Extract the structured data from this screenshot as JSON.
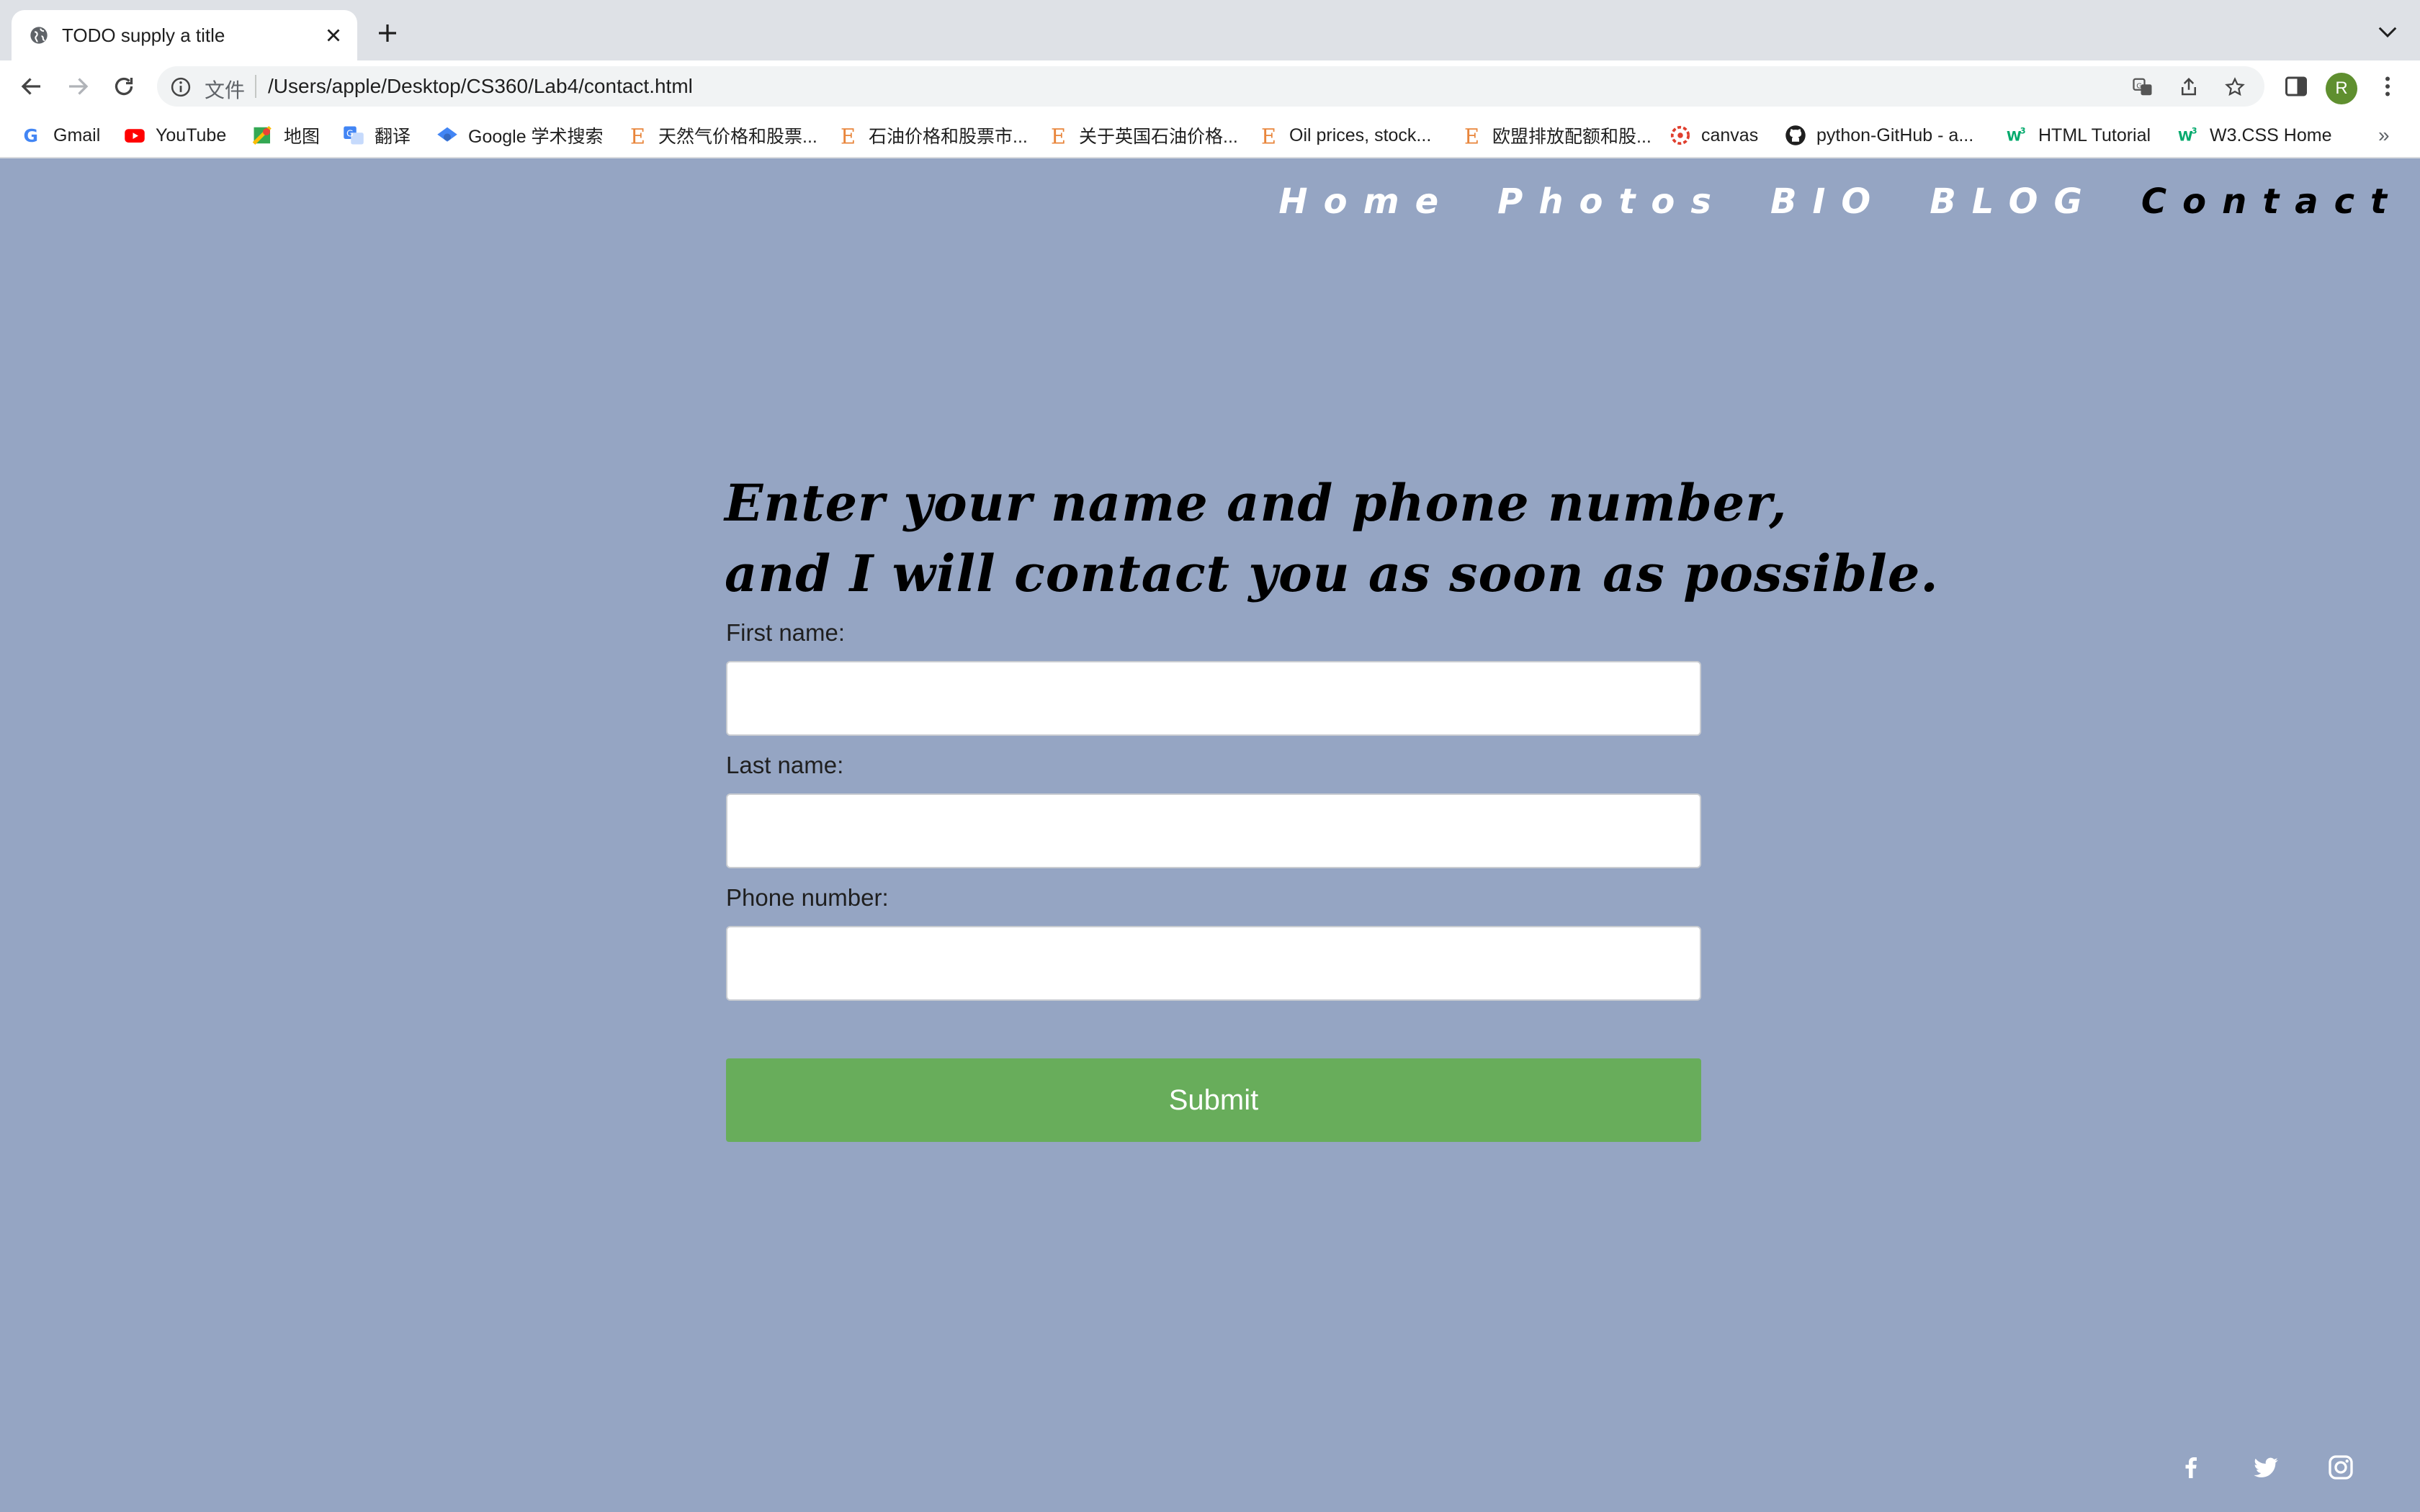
{
  "browser": {
    "tab_title": "TODO supply a title",
    "omnibox_scheme": "文件",
    "url": "/Users/apple/Desktop/CS360/Lab4/contact.html",
    "profile_initial": "R",
    "bookmarks": [
      {
        "label": "Gmail",
        "icon": "gmail-icon"
      },
      {
        "label": "YouTube",
        "icon": "youtube-icon"
      },
      {
        "label": "地图",
        "icon": "maps-icon"
      },
      {
        "label": "翻译",
        "icon": "translate-icon"
      },
      {
        "label": "Google 学术搜索",
        "icon": "scholar-icon"
      },
      {
        "label": "天然气价格和股票...",
        "icon": "e-icon"
      },
      {
        "label": "石油价格和股票市...",
        "icon": "e-icon"
      },
      {
        "label": "关于英国石油价格...",
        "icon": "e-icon"
      },
      {
        "label": "Oil prices, stock...",
        "icon": "e-icon"
      },
      {
        "label": "欧盟排放配额和股...",
        "icon": "e-icon"
      },
      {
        "label": "canvas",
        "icon": "canvas-icon"
      },
      {
        "label": "python-GitHub - a...",
        "icon": "github-icon"
      },
      {
        "label": "HTML Tutorial",
        "icon": "w3-icon"
      },
      {
        "label": "W3.CSS Home",
        "icon": "w3-icon"
      }
    ],
    "bookmarks_overflow": "»"
  },
  "nav": {
    "home": "Home",
    "photos": "Photos",
    "bio": "BIO",
    "blog": "BLOG",
    "contact": "Contact"
  },
  "heading": {
    "line1": "Enter your name and phone number,",
    "line2": "and I will contact you as soon as possible."
  },
  "form": {
    "first_name_label": "First name:",
    "first_name_value": "",
    "last_name_label": "Last name:",
    "last_name_value": "",
    "phone_label": "Phone number:",
    "phone_value": "",
    "submit_label": "Submit"
  },
  "colors": {
    "page_background": "#95a5c3",
    "submit_button": "#68ad5b",
    "nav_active": "#000000",
    "nav_inactive": "#ffffff"
  },
  "social": [
    "facebook-icon",
    "twitter-icon",
    "instagram-icon"
  ]
}
